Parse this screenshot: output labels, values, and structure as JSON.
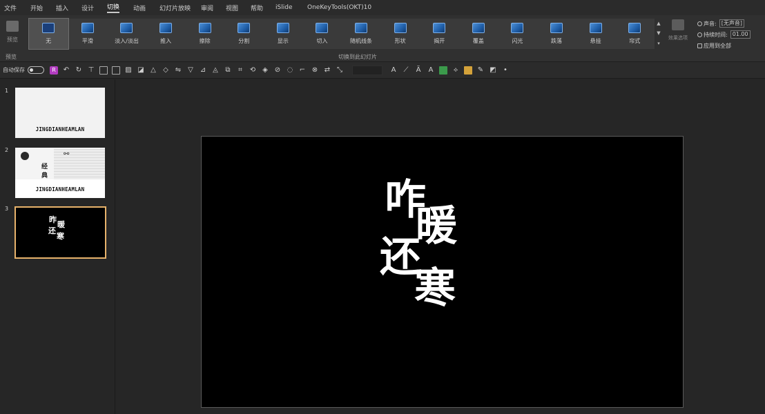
{
  "menu": [
    "文件",
    "开始",
    "插入",
    "设计",
    "切换",
    "动画",
    "幻灯片放映",
    "审阅",
    "视图",
    "帮助",
    "iSlide",
    "OneKeyTools(OKT)10"
  ],
  "ribbon": {
    "preview_label": "预览",
    "preview_group": "预览",
    "group_label": "切换到此幻灯片",
    "effects": [
      "无",
      "平滑",
      "淡入/淡出",
      "推入",
      "擦除",
      "分割",
      "显示",
      "切入",
      "随机线条",
      "形状",
      "揭开",
      "覆盖",
      "闪光",
      "跌落",
      "悬挂",
      "帘式"
    ],
    "effect_options_label": "效果选项",
    "timing": {
      "sound_label": "声音:",
      "sound_value": "[无声音]",
      "duration_label": "持续时间:",
      "duration_value": "01.00",
      "apply_all_label": "应用到全部"
    }
  },
  "toolbar": {
    "autosave_label": "自动保存"
  },
  "thumbnails": [
    {
      "number": "1",
      "caption": "JINGDIANHEAMLAN"
    },
    {
      "number": "2",
      "caption": "JINGDIANHEAMLAN",
      "char1": "经",
      "char2": "典"
    },
    {
      "number": "3",
      "chars": [
        "昨",
        "暖",
        "还",
        "寒"
      ]
    }
  ],
  "slide": {
    "chars": [
      "咋",
      "暖",
      "还",
      "寒"
    ]
  }
}
